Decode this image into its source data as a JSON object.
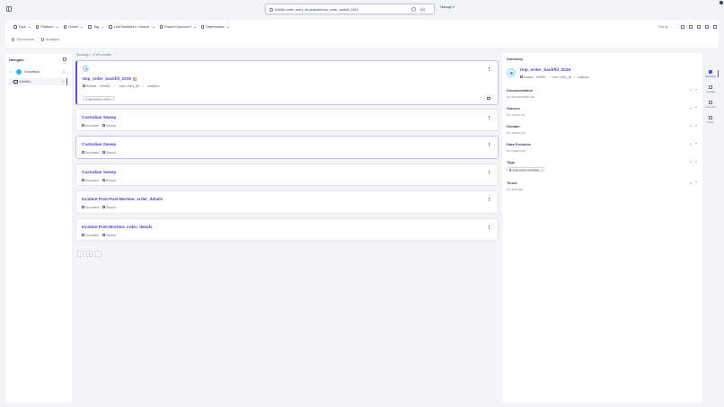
{
  "search": {
    "value": "b2b961.order_entry_db.analytics.tmp_order_backfill_2019",
    "kbd": "⌘K"
  },
  "user_menu": {
    "label": "Manage"
  },
  "filters": [
    "Type",
    "Platform",
    "Owner",
    "Tag",
    "Last Modified In Source",
    "Parent Document",
    "Deprecation"
  ],
  "sort_label": "Sort by",
  "tabs": [
    "Summaries",
    "Analytics"
  ],
  "navigate": {
    "title": "Navigate",
    "tree": [
      {
        "label": "Snowflake",
        "count": "2"
      },
      {
        "label": "b2b961",
        "count": "1"
      }
    ]
  },
  "results_count": "Showing 1 - 6 of 6 results",
  "results": [
    {
      "title": "tmp_order_backfill_2019",
      "type": "Dataset",
      "path": [
        "b2b961",
        "order_entry_db",
        "analytics"
      ],
      "pill": "deprecation notice"
    },
    {
      "title": "Custodian Sweep",
      "type": "Document",
      "status": "Shared"
    },
    {
      "title": "Custodian Sweep",
      "type": "Document",
      "status": "Shared"
    },
    {
      "title": "Custodian Sweep",
      "type": "Document",
      "status": "Shared"
    },
    {
      "title": "Incident Post-Post-Mortem: order_details",
      "type": "Document",
      "status": "Shared"
    },
    {
      "title": "Incident Post-Mortem: order_details",
      "type": "Document",
      "status": "Shared"
    }
  ],
  "pagination": {
    "prev": "‹",
    "page": "1",
    "next": "›"
  },
  "summary": {
    "title": "Summary",
    "entity_title": "tmp_order_backfill_2019",
    "entity_type": "Dataset",
    "path": [
      "b2b961",
      "order_entry_db",
      "analytics"
    ],
    "sections": [
      {
        "title": "Documentation",
        "empty": "No documentation yet"
      },
      {
        "title": "Owners",
        "empty": "No owners yet"
      },
      {
        "title": "Domain",
        "empty": "No domain yet"
      },
      {
        "title": "Data Products",
        "empty": "No product yet"
      },
      {
        "title": "Tags",
        "tag": "deprecation-candidate"
      },
      {
        "title": "Terms",
        "empty": "No terms yet"
      }
    ]
  },
  "rail": [
    "Summary",
    "Lineage",
    "Columns",
    "Props"
  ]
}
